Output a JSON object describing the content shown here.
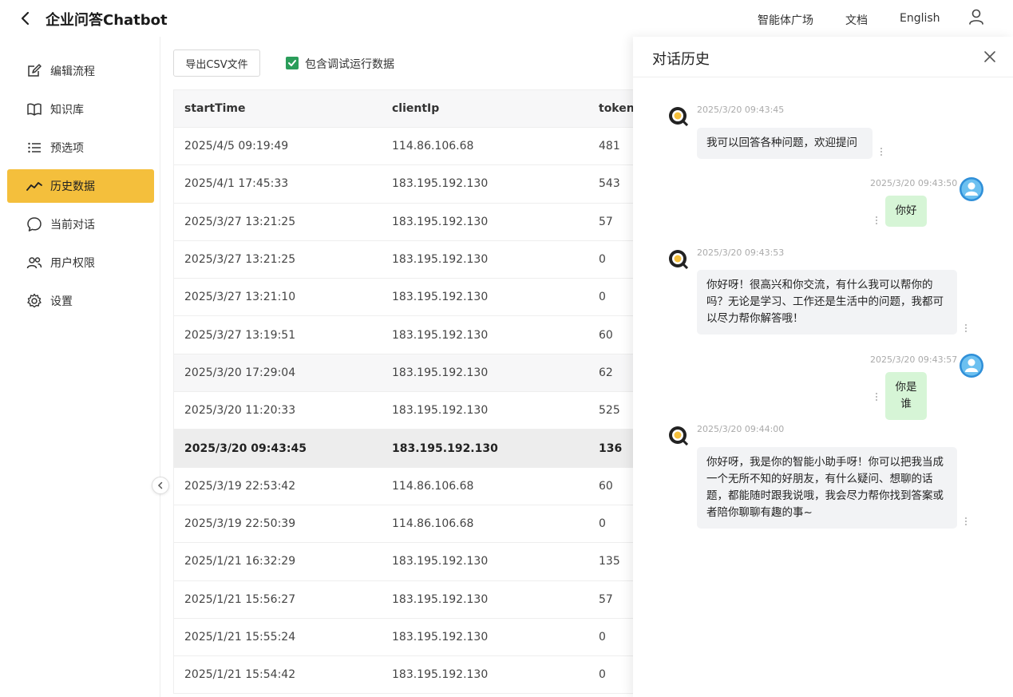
{
  "header": {
    "title": "企业问答Chatbot",
    "nav": [
      "智能体广场",
      "文档",
      "English"
    ]
  },
  "sidebar": {
    "items": [
      {
        "label": "编辑流程",
        "icon": "edit-icon"
      },
      {
        "label": "知识库",
        "icon": "book-icon"
      },
      {
        "label": "预选项",
        "icon": "list-icon"
      },
      {
        "label": "历史数据",
        "icon": "trend-icon",
        "active": true
      },
      {
        "label": "当前对话",
        "icon": "chat-icon"
      },
      {
        "label": "用户权限",
        "icon": "users-icon"
      },
      {
        "label": "设置",
        "icon": "gear-icon"
      }
    ],
    "active_color": "#f4bf3c"
  },
  "toolbar": {
    "export_label": "导出CSV文件",
    "debug_label": "包含调试运行数据",
    "debug_checked": true
  },
  "table": {
    "headers": [
      "startTime",
      "clientIp",
      "tokenU"
    ],
    "rows": [
      [
        "2025/4/5 09:19:49",
        "114.86.106.68",
        "481"
      ],
      [
        "2025/4/1 17:45:33",
        "183.195.192.130",
        "543"
      ],
      [
        "2025/3/27 13:21:25",
        "183.195.192.130",
        "57"
      ],
      [
        "2025/3/27 13:21:25",
        "183.195.192.130",
        "0"
      ],
      [
        "2025/3/27 13:21:10",
        "183.195.192.130",
        "0"
      ],
      [
        "2025/3/27 13:19:51",
        "183.195.192.130",
        "60"
      ],
      [
        "2025/3/20 17:29:04",
        "183.195.192.130",
        "62"
      ],
      [
        "2025/3/20 11:20:33",
        "183.195.192.130",
        "525"
      ],
      [
        "2025/3/20 09:43:45",
        "183.195.192.130",
        "136"
      ],
      [
        "2025/3/19 22:53:42",
        "114.86.106.68",
        "60"
      ],
      [
        "2025/3/19 22:50:39",
        "114.86.106.68",
        "0"
      ],
      [
        "2025/1/21 16:32:29",
        "183.195.192.130",
        "135"
      ],
      [
        "2025/1/21 15:56:27",
        "183.195.192.130",
        "57"
      ],
      [
        "2025/1/21 15:55:24",
        "183.195.192.130",
        "0"
      ],
      [
        "2025/1/21 15:54:42",
        "183.195.192.130",
        "0"
      ]
    ],
    "selected_index": 8
  },
  "drawer": {
    "title": "对话历史",
    "messages": [
      {
        "role": "bot",
        "time": "2025/3/20 09:43:45",
        "text": "我可以回答各种问题，欢迎提问"
      },
      {
        "role": "user",
        "time": "2025/3/20 09:43:50",
        "text": "你好"
      },
      {
        "role": "bot",
        "time": "2025/3/20 09:43:53",
        "text": "你好呀！很高兴和你交流，有什么我可以帮你的吗？无论是学习、工作还是生活中的问题，我都可以尽力帮你解答哦！"
      },
      {
        "role": "user",
        "time": "2025/3/20 09:43:57",
        "text": "你是谁"
      },
      {
        "role": "bot",
        "time": "2025/3/20 09:44:00",
        "text": "你好呀，我是你的智能小助手呀！你可以把我当成一个无所不知的好朋友，有什么疑问、想聊的话题，都能随时跟我说哦，我会尽力帮你找到答案或者陪你聊聊有趣的事~"
      }
    ]
  }
}
